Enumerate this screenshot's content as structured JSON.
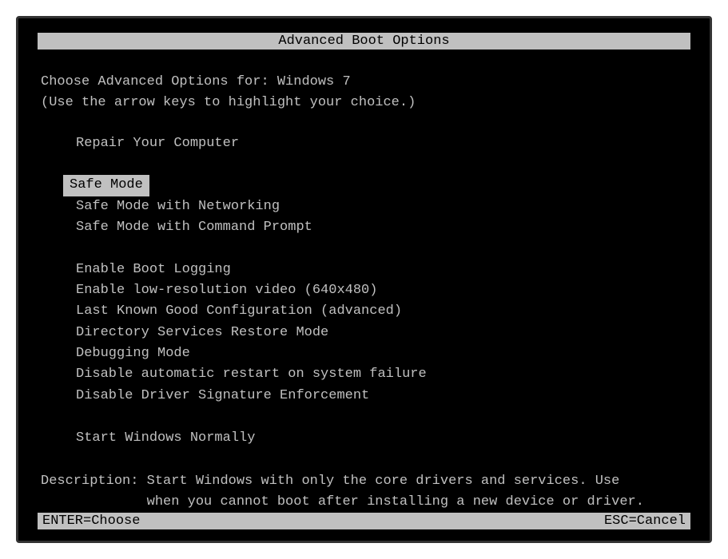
{
  "title": "Advanced Boot Options",
  "instruction_line1": "Choose Advanced Options for: Windows 7",
  "instruction_line2": "(Use the arrow keys to highlight your choice.)",
  "options": {
    "group1": [
      "Repair Your Computer"
    ],
    "group2": [
      "Safe Mode",
      "Safe Mode with Networking",
      "Safe Mode with Command Prompt"
    ],
    "group3": [
      "Enable Boot Logging",
      "Enable low-resolution video (640x480)",
      "Last Known Good Configuration (advanced)",
      "Directory Services Restore Mode",
      "Debugging Mode",
      "Disable automatic restart on system failure",
      "Disable Driver Signature Enforcement"
    ],
    "group4": [
      "Start Windows Normally"
    ]
  },
  "selected_option": "Safe Mode",
  "description_label": "Description: ",
  "description_text": "Start Windows with only the core drivers and services. Use\n             when you cannot boot after installing a new device or driver.",
  "footer": {
    "enter": "ENTER=Choose",
    "esc": "ESC=Cancel"
  }
}
